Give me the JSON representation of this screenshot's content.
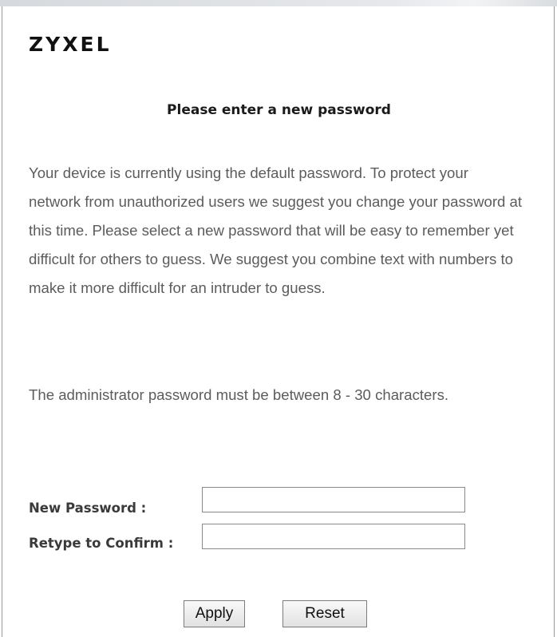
{
  "brand": {
    "logo_text": "ZYXEL"
  },
  "dialog": {
    "title": "Please enter a new password",
    "description": "Your device is currently using the default password. To protect your network from unauthorized users we suggest you change your password at this time. Please select a new password that will be easy to remember yet difficult for others to guess. We suggest you combine text with numbers to make it more difficult for an intruder to guess.",
    "requirement": "The administrator password must be between 8 - 30 characters."
  },
  "form": {
    "new_password": {
      "label": "New Password :",
      "value": ""
    },
    "confirm_password": {
      "label": "Retype to Confirm :",
      "value": ""
    }
  },
  "actions": {
    "apply_label": "Apply",
    "reset_label": "Reset"
  }
}
